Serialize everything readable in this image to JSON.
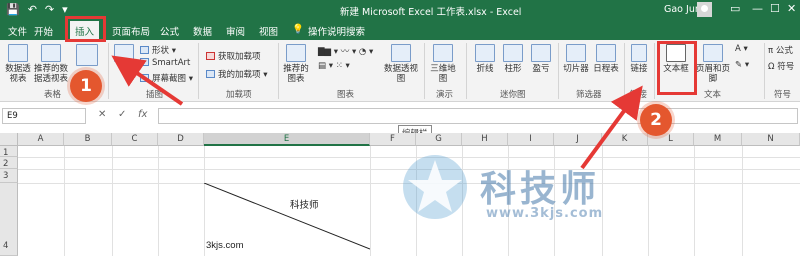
{
  "titlebar": {
    "doc_title": "新建 Microsoft Excel 工作表.xlsx  -  Excel",
    "user": "Gao Jun",
    "qat": [
      "💾",
      "↶",
      "↷",
      "▾"
    ],
    "win": [
      "▭",
      "—",
      "☐",
      "✕"
    ]
  },
  "tabs": [
    {
      "label": "文件"
    },
    {
      "label": "开始"
    },
    {
      "label": "插入"
    },
    {
      "label": "页面布局"
    },
    {
      "label": "公式"
    },
    {
      "label": "数据"
    },
    {
      "label": "审阅"
    },
    {
      "label": "视图"
    },
    {
      "label": "操作说明搜索"
    }
  ],
  "ribbon": {
    "pivot": "数据透视表",
    "rec_pivot": "推荐的数据透视表",
    "table_group": "表格",
    "shapes": "形状 ▾",
    "smartart": "SmartArt",
    "screenshot": "屏幕截图 ▾",
    "illus_group": "插图",
    "get_addins": "获取加载项",
    "my_addins": "我的加载项",
    "addins_group": "加载项",
    "rec_charts": "推荐的图表",
    "pivot_chart": "数据透视图",
    "charts_group": "图表",
    "map3d": "三维地图",
    "tours_group": "演示",
    "line": "折线",
    "column": "柱形",
    "winloss": "盈亏",
    "spark_group": "迷你图",
    "slicer": "切片器",
    "timeline": "日程表",
    "filter_group": "筛选器",
    "link": "链接",
    "link_group": "链接",
    "textbox": "文本框",
    "header_footer": "页眉和页脚",
    "text_group": "文本",
    "pi": "π 公式",
    "omega": "Ω 符号",
    "symbol_group": "符号"
  },
  "formula_bar": {
    "namebox": "E9",
    "cancel": "✕",
    "enter": "✓",
    "fx": "fx",
    "tooltip": "编辑栏"
  },
  "grid": {
    "columns": [
      "A",
      "B",
      "C",
      "D",
      "E",
      "F",
      "G",
      "H",
      "I",
      "J",
      "K",
      "L",
      "M",
      "N"
    ],
    "rows": [
      "1",
      "2",
      "3",
      "4"
    ],
    "e3_text": "科技师",
    "e4_text": "3kjs.com"
  },
  "annotations": {
    "step1": "1",
    "step2": "2",
    "marker_color": "#e53935"
  },
  "watermark": {
    "text": "科技师",
    "url": "www.3kjs.com"
  }
}
